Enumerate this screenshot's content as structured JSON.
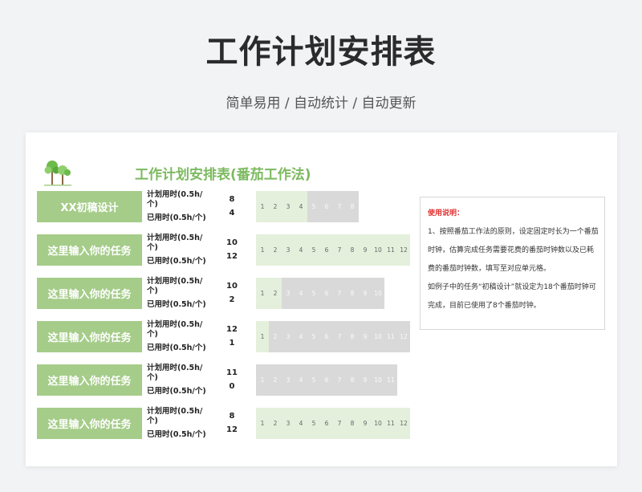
{
  "header": {
    "title": "工作计划安排表",
    "subtitle": "简单易用  /  自动统计  /  自动更新"
  },
  "sheet": {
    "title": "工作计划安排表(番茄工作法)",
    "plan_label": "计划用时(0.5h/个)",
    "used_label": "已用时(0.5h/个)",
    "tasks": [
      {
        "name": "XX初稿设计",
        "planned": "8",
        "used": "4"
      },
      {
        "name": "这里输入你的任务",
        "planned": "10",
        "used": "12"
      },
      {
        "name": "这里输入你的任务",
        "planned": "10",
        "used": "2"
      },
      {
        "name": "这里输入你的任务",
        "planned": "12",
        "used": "1"
      },
      {
        "name": "这里输入你的任务",
        "planned": "11",
        "used": "0"
      },
      {
        "name": "这里输入你的任务",
        "planned": "8",
        "used": "12"
      }
    ]
  },
  "notes": {
    "heading": "使用说明：",
    "paragraphs": [
      "1、按照番茄工作法的原则，设定固定时长为一个番茄时钟，估算完成任务需要花费的番茄时钟数以及已耗费的番茄时钟数，填写至对应单元格。",
      "如例子中的任务“初稿设计”就设定为18个番茄时钟可完成，目前已使用了8个番茄时钟。"
    ]
  },
  "colors": {
    "task_green": "#a5cc89",
    "used_slot": "#e4f0dc",
    "remaining_slot": "#d9d9d9",
    "title_green": "#7cb95f",
    "notes_heading": "#e03131"
  },
  "icons": {
    "logo": "trees-icon"
  }
}
